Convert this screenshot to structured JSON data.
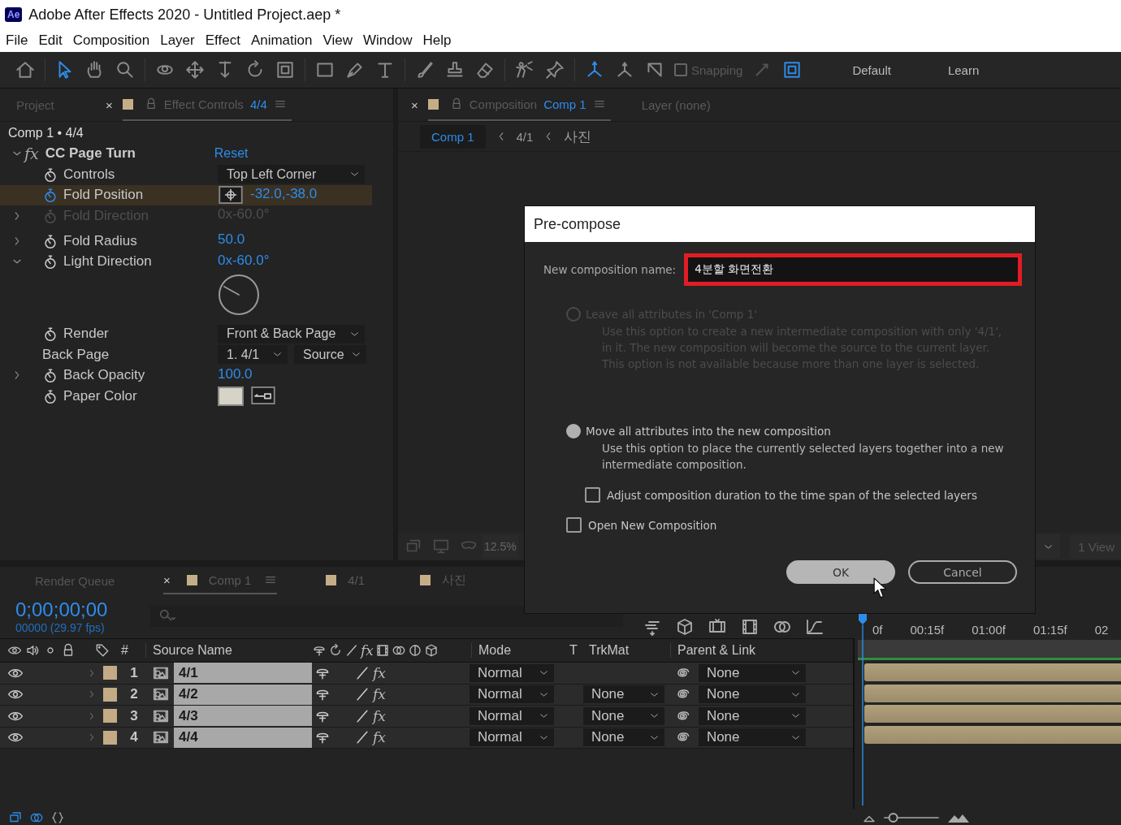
{
  "window": {
    "logo": "Ae",
    "title": "Adobe After Effects 2020 - Untitled Project.aep *"
  },
  "menu": [
    "File",
    "Edit",
    "Composition",
    "Layer",
    "Effect",
    "Animation",
    "View",
    "Window",
    "Help"
  ],
  "toolbar": {
    "snapping": {
      "label": "Snapping",
      "checked": false
    },
    "workspaces": [
      "Default",
      "Learn"
    ]
  },
  "effect_panel": {
    "tabs": [
      {
        "label": "Project",
        "selected": false
      },
      {
        "label": "Effect Controls",
        "suffix": "4/4",
        "selected": true
      }
    ],
    "close": "×",
    "breadcrumb": "Comp 1 • 4/4",
    "effect": {
      "fx": "fx",
      "name": "CC Page Turn",
      "reset": "Reset",
      "expanded": true
    },
    "properties": [
      {
        "kind": "dropdown",
        "name": "Controls",
        "value": "Top Left Corner",
        "stopwatch": true,
        "selected": false,
        "disabled": false
      },
      {
        "kind": "point",
        "name": "Fold Position",
        "value": "-32.0,-38.0",
        "stopwatch": true,
        "selected": true,
        "disabled": false
      },
      {
        "kind": "angle",
        "name": "Fold Direction",
        "value": "0x-60.0°",
        "stopwatch": true,
        "expanded": false,
        "selected": false,
        "disabled": true
      },
      {
        "kind": "number",
        "name": "Fold Radius",
        "value": "50.0",
        "stopwatch": true,
        "expanded": false,
        "selected": false,
        "disabled": false
      },
      {
        "kind": "angle",
        "name": "Light Direction",
        "value": "0x-60.0°",
        "stopwatch": true,
        "expanded": true,
        "selected": false,
        "disabled": false
      },
      {
        "kind": "dropdown",
        "name": "Render",
        "value": "Front & Back Page",
        "stopwatch": true,
        "selected": false,
        "disabled": false
      },
      {
        "kind": "layer_select",
        "name": "Back Page",
        "values": [
          "1. 4/1",
          "Source"
        ],
        "stopwatch": false,
        "selected": false,
        "disabled": false
      },
      {
        "kind": "number",
        "name": "Back Opacity",
        "value": "100.0",
        "stopwatch": true,
        "expanded": false,
        "selected": false,
        "disabled": false
      },
      {
        "kind": "color",
        "name": "Paper Color",
        "color": "#d6d3c7",
        "stopwatch": true,
        "selected": false,
        "disabled": false
      }
    ]
  },
  "comp_panel": {
    "close": "×",
    "tab_label": "Composition",
    "tab_comp": "Comp 1",
    "layer_tab": "Layer (none)",
    "breadcrumbs": [
      {
        "label": "Comp 1",
        "selected": true
      },
      {
        "label": "4/1",
        "selected": false
      },
      {
        "label": "사진",
        "selected": false
      }
    ],
    "zoom": "12.5%",
    "views": "1 View"
  },
  "timeline": {
    "tabs": [
      {
        "label": "Render Queue",
        "selected": false
      },
      {
        "label": "Comp 1",
        "selected": true
      },
      {
        "label": "4/1",
        "selected": false
      },
      {
        "label": "사진",
        "selected": false
      }
    ],
    "close": "×",
    "timecode": "0;00;00;00",
    "frames": "00000 (29.97 fps)",
    "ruler": [
      "0f",
      "00:15f",
      "01:00f",
      "01:15f",
      "02"
    ],
    "zoom_slider": {
      "level": 0.1
    },
    "columns": {
      "number": "#",
      "source": "Source Name",
      "fx": "fx",
      "mode": "Mode",
      "t": "T",
      "trkmat": "TrkMat",
      "parent": "Parent & Link"
    },
    "layers": [
      {
        "number": "1",
        "name": "4/1",
        "color": "#c2ab85",
        "selected": true,
        "fx": "fx",
        "effects_on": true,
        "mode": "Normal",
        "parent": "None"
      },
      {
        "number": "2",
        "name": "4/2",
        "color": "#c2ab85",
        "selected": true,
        "fx": "fx",
        "effects_on": true,
        "mode": "Normal",
        "trkmat": "None",
        "parent": "None"
      },
      {
        "number": "3",
        "name": "4/3",
        "color": "#c2ab85",
        "selected": true,
        "fx": "fx",
        "effects_on": true,
        "mode": "Normal",
        "trkmat": "None",
        "parent": "None"
      },
      {
        "number": "4",
        "name": "4/4",
        "color": "#c2ab85",
        "selected": true,
        "fx": "fx",
        "effects_on": true,
        "mode": "Normal",
        "trkmat": "None",
        "parent": "None"
      }
    ]
  },
  "dialog": {
    "title": "Pre-compose",
    "name_label": "New composition name:",
    "name_value": "4분할 화면전환",
    "name_highlighted": true,
    "options": [
      {
        "label": "Leave all attributes in 'Comp 1'",
        "description": "Use this option to create a new intermediate composition with only '4/1', in it. The new composition will become the source to the current layer. This option is not available because more than one layer is selected.",
        "selected": false,
        "disabled": true
      },
      {
        "label": "Move all attributes into the new composition",
        "description": "Use this option to place the currently selected layers together into a new intermediate composition.",
        "selected": true,
        "disabled": false
      }
    ],
    "checkboxes": [
      {
        "label": "Adjust composition duration to the time span of the selected layers",
        "checked": false,
        "indented": true
      },
      {
        "label": "Open New Composition",
        "checked": false,
        "indented": false
      }
    ],
    "buttons": [
      {
        "label": "OK",
        "primary": true
      },
      {
        "label": "Cancel",
        "primary": false
      }
    ]
  }
}
